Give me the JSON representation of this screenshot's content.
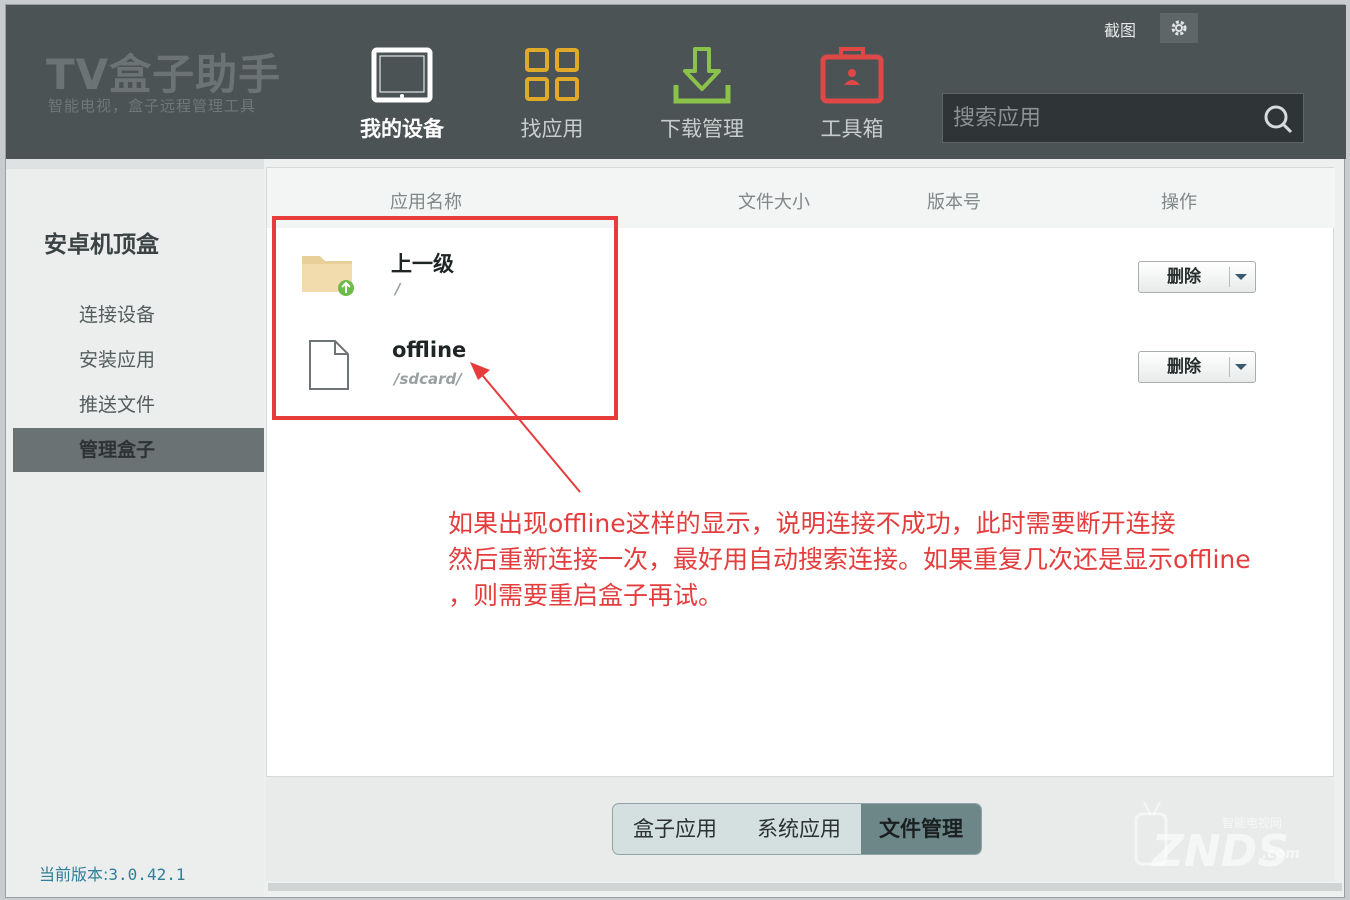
{
  "app": {
    "logo_title": "TV盒子助手",
    "logo_subtitle": "智能电视，盒子远程管理工具",
    "screenshot_label": "截图"
  },
  "nav": {
    "items": [
      {
        "label": "我的设备",
        "icon": "tablet-icon",
        "active": true
      },
      {
        "label": "找应用",
        "icon": "grid-icon",
        "color": "#e0a92a"
      },
      {
        "label": "下载管理",
        "icon": "download-icon",
        "color": "#8bc34a"
      },
      {
        "label": "工具箱",
        "icon": "toolbox-icon",
        "color": "#e04848"
      }
    ]
  },
  "search": {
    "placeholder": "搜索应用"
  },
  "sidebar": {
    "title": "安卓机顶盒",
    "items": [
      {
        "label": "连接设备"
      },
      {
        "label": "安装应用"
      },
      {
        "label": "推送文件"
      },
      {
        "label": "管理盒子",
        "active": true
      }
    ],
    "version_label": "当前版本:",
    "version_value": "3.0.42.1"
  },
  "table": {
    "headers": [
      "应用名称",
      "文件大小",
      "版本号",
      "操作"
    ],
    "rows": [
      {
        "name": "上一级",
        "path": "/",
        "icon": "folder-up-icon",
        "action": "删除"
      },
      {
        "name": "offline",
        "path": "/sdcard/",
        "icon": "file-icon",
        "action": "删除"
      }
    ]
  },
  "annotation": {
    "line1": "如果出现offline这样的显示，说明连接不成功，此时需要断开连接",
    "line2": "然后重新连接一次，最好用自动搜索连接。如果重复几次还是显示offline",
    "line3": "，则需要重启盒子再试。"
  },
  "bottom_tabs": {
    "items": [
      {
        "label": "盒子应用"
      },
      {
        "label": "系统应用"
      },
      {
        "label": "文件管理",
        "active": true
      }
    ]
  },
  "watermark": {
    "text": "ZNDS",
    "small": "智能电视网",
    "com": ".com"
  },
  "colors": {
    "header_bg": "#4c5354",
    "highlight": "#e63c3c",
    "active_side": "#6b7273"
  }
}
